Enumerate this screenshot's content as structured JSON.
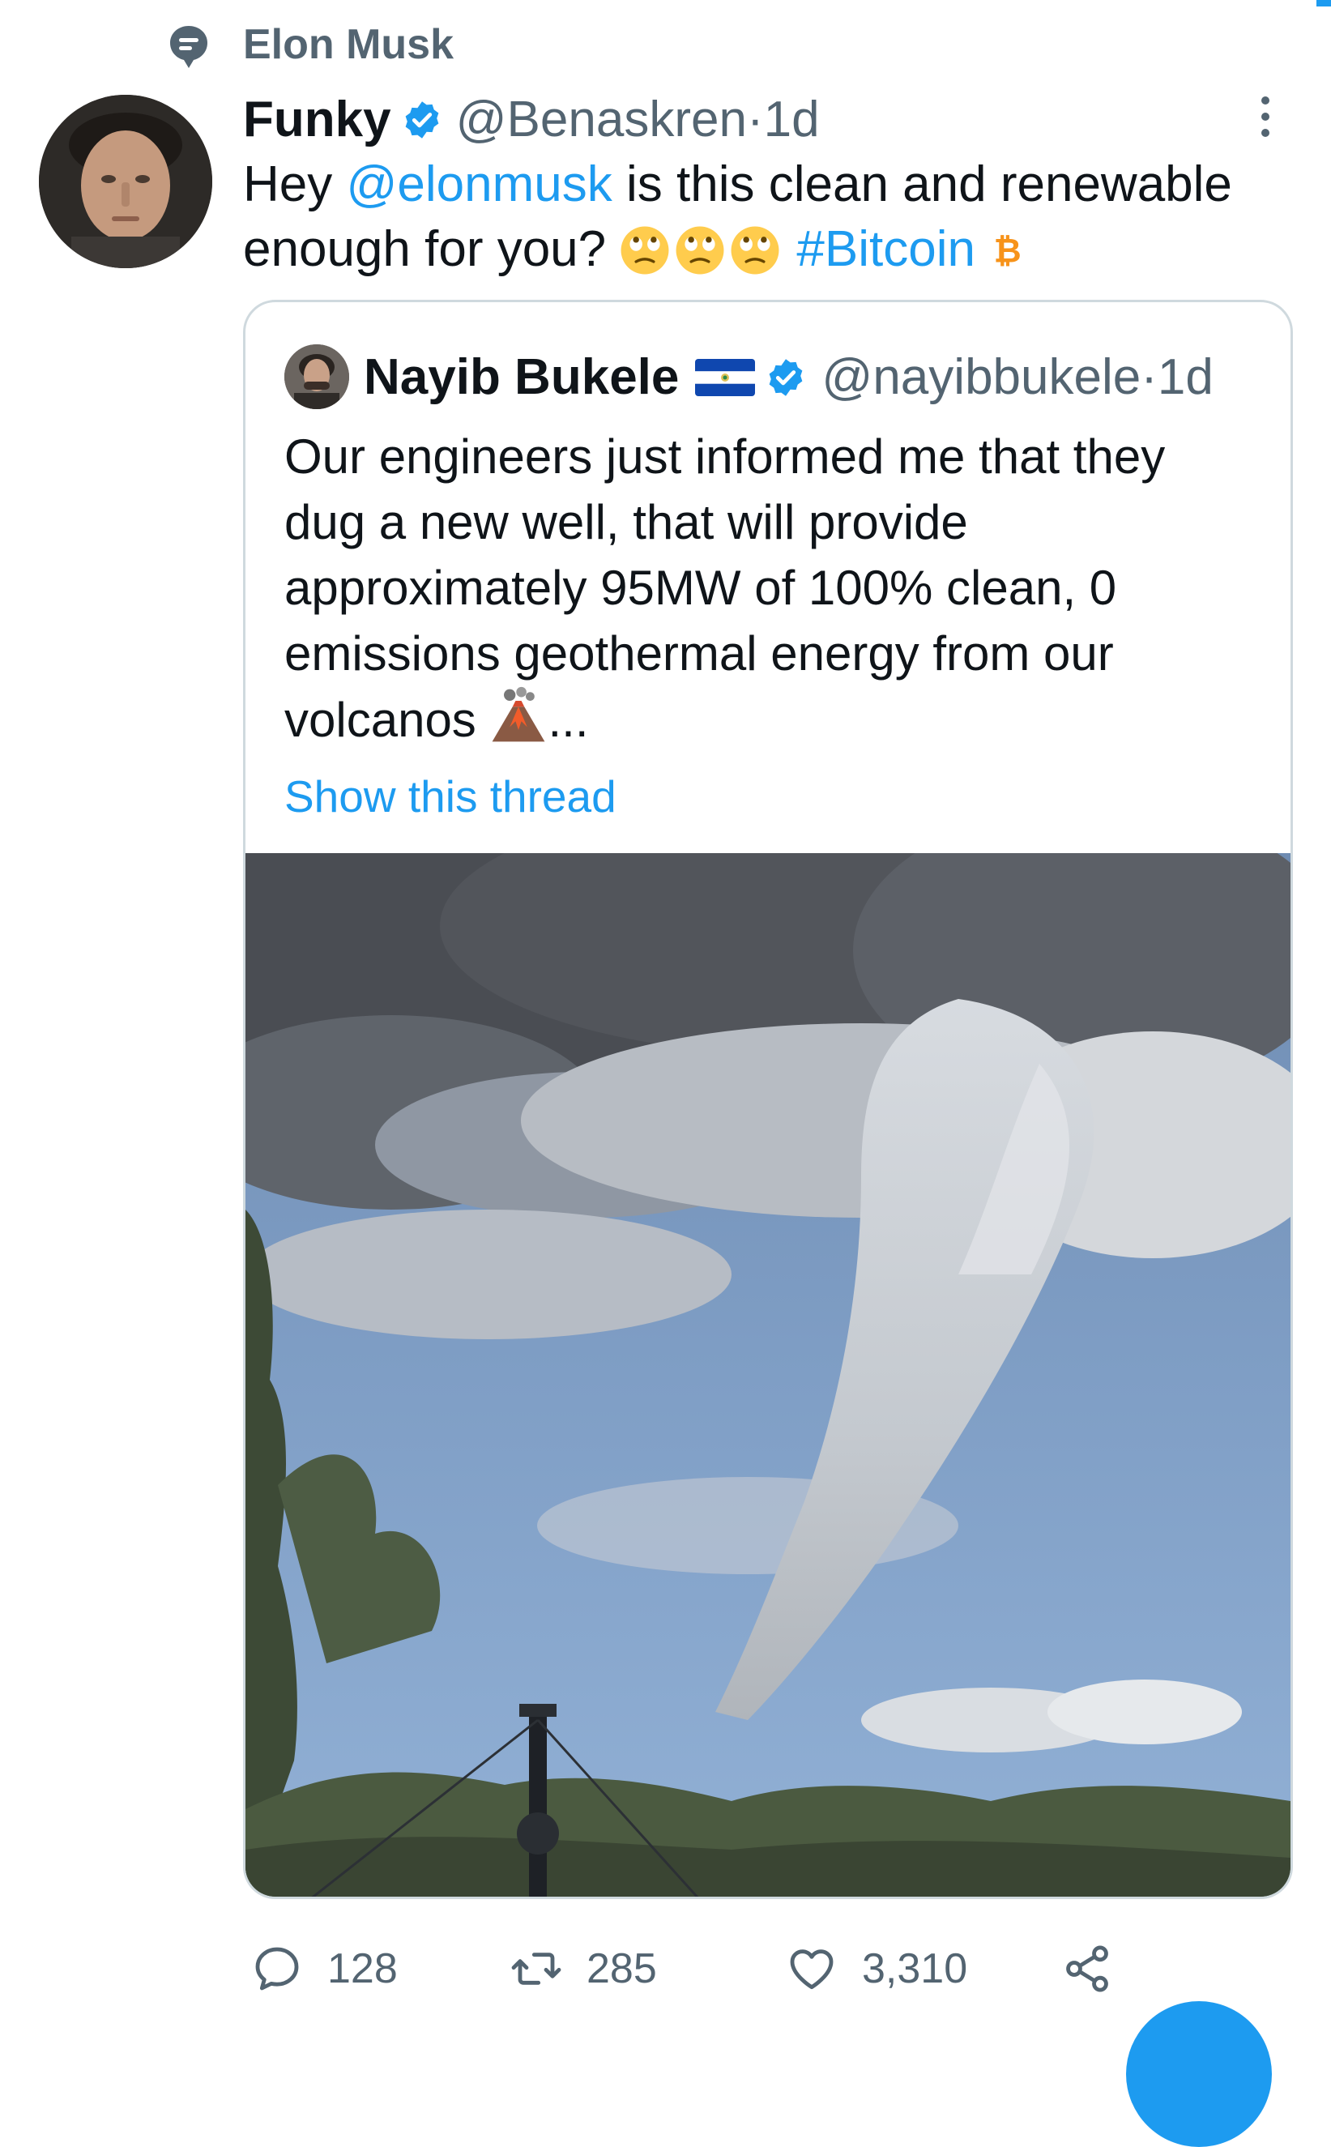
{
  "social_context": {
    "label": "Elon Musk"
  },
  "tweet": {
    "author_name": "Funky",
    "handle": "@Benaskren",
    "separator": " · ",
    "time": "1d",
    "text_parts": {
      "t1": "Hey ",
      "mention": "@elonmusk",
      "t2": " is this clean and renewable enough for you? ",
      "hashtag": "#Bitcoin"
    },
    "emoji": [
      "face-with-rolling-eyes",
      "face-with-rolling-eyes",
      "face-with-rolling-eyes",
      "bitcoin-sign"
    ]
  },
  "quoted_tweet": {
    "author_name": "Nayib Bukele",
    "handle": "@nayibbukele",
    "separator": " · ",
    "time": "1d",
    "flag": "el-salvador-flag",
    "text": "Our engineers just informed me that they dug a new well, that will provide approximately 95MW of 100% clean, 0 emissions geothermal energy from our volcanos",
    "ellipsis": "...",
    "emoji": [
      "volcano"
    ],
    "show_thread": "Show this thread",
    "media": "geothermal-well-steam-plume-photo"
  },
  "actions": {
    "reply_count": "128",
    "retweet_count": "285",
    "like_count": "3,310"
  },
  "colors": {
    "accent": "#1d9bf0",
    "secondary_text": "#536471",
    "border": "#cfd9de",
    "verified": "#1d9bf0"
  }
}
